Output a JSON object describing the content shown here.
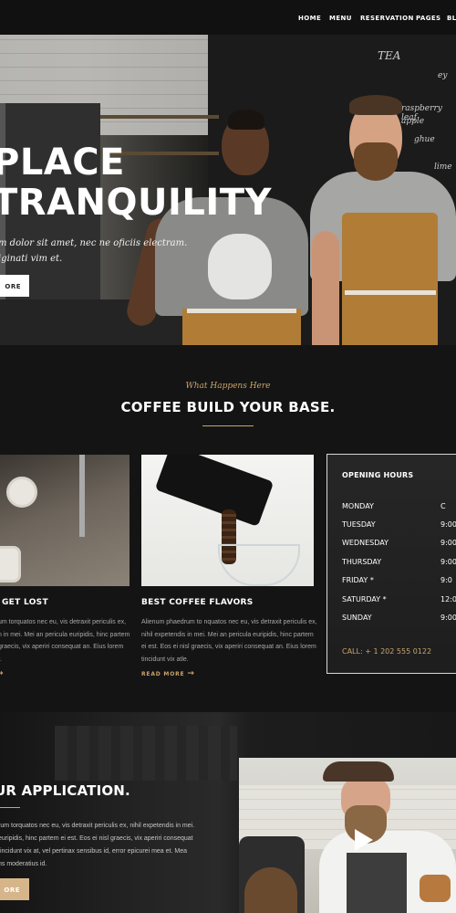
{
  "nav": {
    "items": [
      "HOME",
      "MENU",
      "RESERVATION",
      "PAGES",
      "BL"
    ]
  },
  "hero": {
    "title_line1": "PLACE",
    "title_line2": "TRANQUILITY",
    "text_line1": "m dolor sit amet, nec ne oficiis electram.",
    "text_line2": "iginati vim et.",
    "button_label": "ORE",
    "chalkboard": [
      "TEA",
      "ey",
      "raspberry leaf",
      "apple",
      "ghue",
      "lime"
    ]
  },
  "section": {
    "eyebrow": "What Happens Here",
    "title": "COFFEE BUILD YOUR BASE."
  },
  "cards": [
    {
      "title": "GET LOST",
      "lines": [
        "um torquatos nec eu, vis detraxit periculis ex,",
        "n in mei. Mei an pericula euripidis, hinc partem",
        "graecis, vix aperiri consequat an. Eius lorem",
        "r."
      ],
      "read_more": ""
    },
    {
      "title": "BEST COFFEE FLAVORS",
      "lines": [
        "Alienum phaedrum to nquatos nec eu, vis detraxit periculis ex,",
        "nihil expetendis in mei. Mei an pericula euripidis, hinc partem",
        "ei est. Eos ei nisl graecis, vix aperiri consequat an. Eius lorem",
        "tincidunt vix atle."
      ],
      "read_more": "READ MORE"
    }
  ],
  "hours": {
    "title": "OPENING HOURS",
    "rows": [
      {
        "day": "MONDAY",
        "time": "C"
      },
      {
        "day": "TUESDAY",
        "time": "9:00"
      },
      {
        "day": "WEDNESDAY",
        "time": "9:00"
      },
      {
        "day": "THURSDAY",
        "time": "9:00"
      },
      {
        "day": "FRIDAY *",
        "time": "9:0"
      },
      {
        "day": "SATURDAY *",
        "time": "12:00"
      },
      {
        "day": "SUNDAY",
        "time": "9:00"
      }
    ],
    "call": "CALL: + 1 202 555 0122"
  },
  "application": {
    "title": "UR APPLICATION.",
    "lines": [
      "rum torquatos nec eu, vis detraxit periculis ex, nihil expetendis in mei.",
      "euripidis, hinc partem ei est. Eos ei nisl graecis, vix aperiri consequat",
      "tincidunt vix at, vel pertinax sensibus id, error epicurei mea et. Mea",
      "ns moderatius id."
    ],
    "button_label": "ORE"
  },
  "colors": {
    "accent": "#c9a46a",
    "background": "#141414",
    "button_tan": "#d7b58a"
  }
}
